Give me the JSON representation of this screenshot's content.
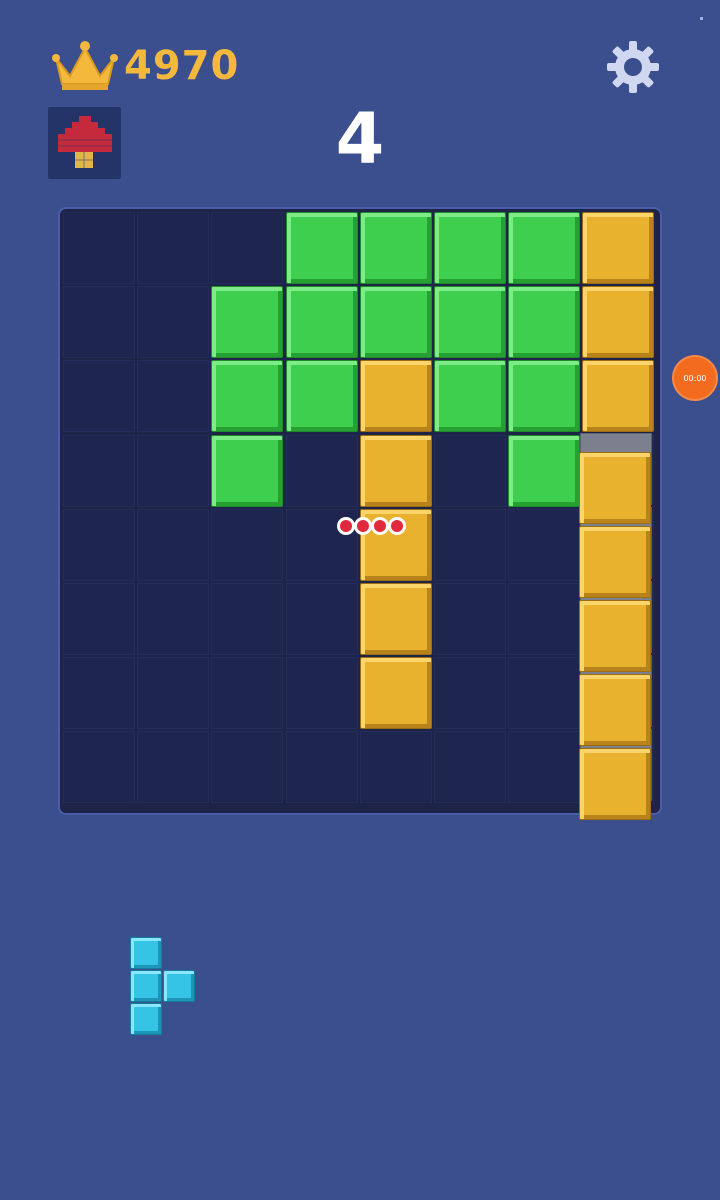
{
  "header": {
    "best_score": "4970",
    "current_score": "4",
    "icons": {
      "crown": "crown-icon",
      "settings": "gear-icon",
      "theme": "mushroom-pixel-icon"
    },
    "colors": {
      "crown": "#f4b83c",
      "score": "#ffffff",
      "background": "#3b4f8f"
    }
  },
  "board": {
    "rows": 8,
    "cols": 8,
    "colors": {
      "green": "#3fcf4e",
      "gold": "#e8b22f",
      "empty": "#1e2650"
    },
    "cells": [
      [
        null,
        null,
        null,
        "green",
        "green",
        "green",
        "green",
        "gold"
      ],
      [
        null,
        null,
        "green",
        "green",
        "green",
        "green",
        "green",
        "gold"
      ],
      [
        null,
        null,
        "green",
        "green",
        "gold",
        "green",
        "green",
        "gold"
      ],
      [
        null,
        null,
        "green",
        null,
        "gold",
        null,
        "green",
        null
      ],
      [
        null,
        null,
        null,
        null,
        "gold",
        null,
        null,
        null
      ],
      [
        null,
        null,
        null,
        null,
        "gold",
        null,
        null,
        null
      ],
      [
        null,
        null,
        null,
        null,
        "gold",
        null,
        null,
        null
      ],
      [
        null,
        null,
        null,
        null,
        null,
        null,
        null,
        null
      ]
    ]
  },
  "dragged_piece": {
    "color": "gold",
    "shape": "vertical-5"
  },
  "combo_indicator": {
    "dots": 4,
    "color": "#e02a3c"
  },
  "tray_piece": {
    "color": "#35c3e6",
    "shape": "T-right"
  },
  "side_button": {
    "label": "00:00",
    "color": "#f26b1f"
  }
}
